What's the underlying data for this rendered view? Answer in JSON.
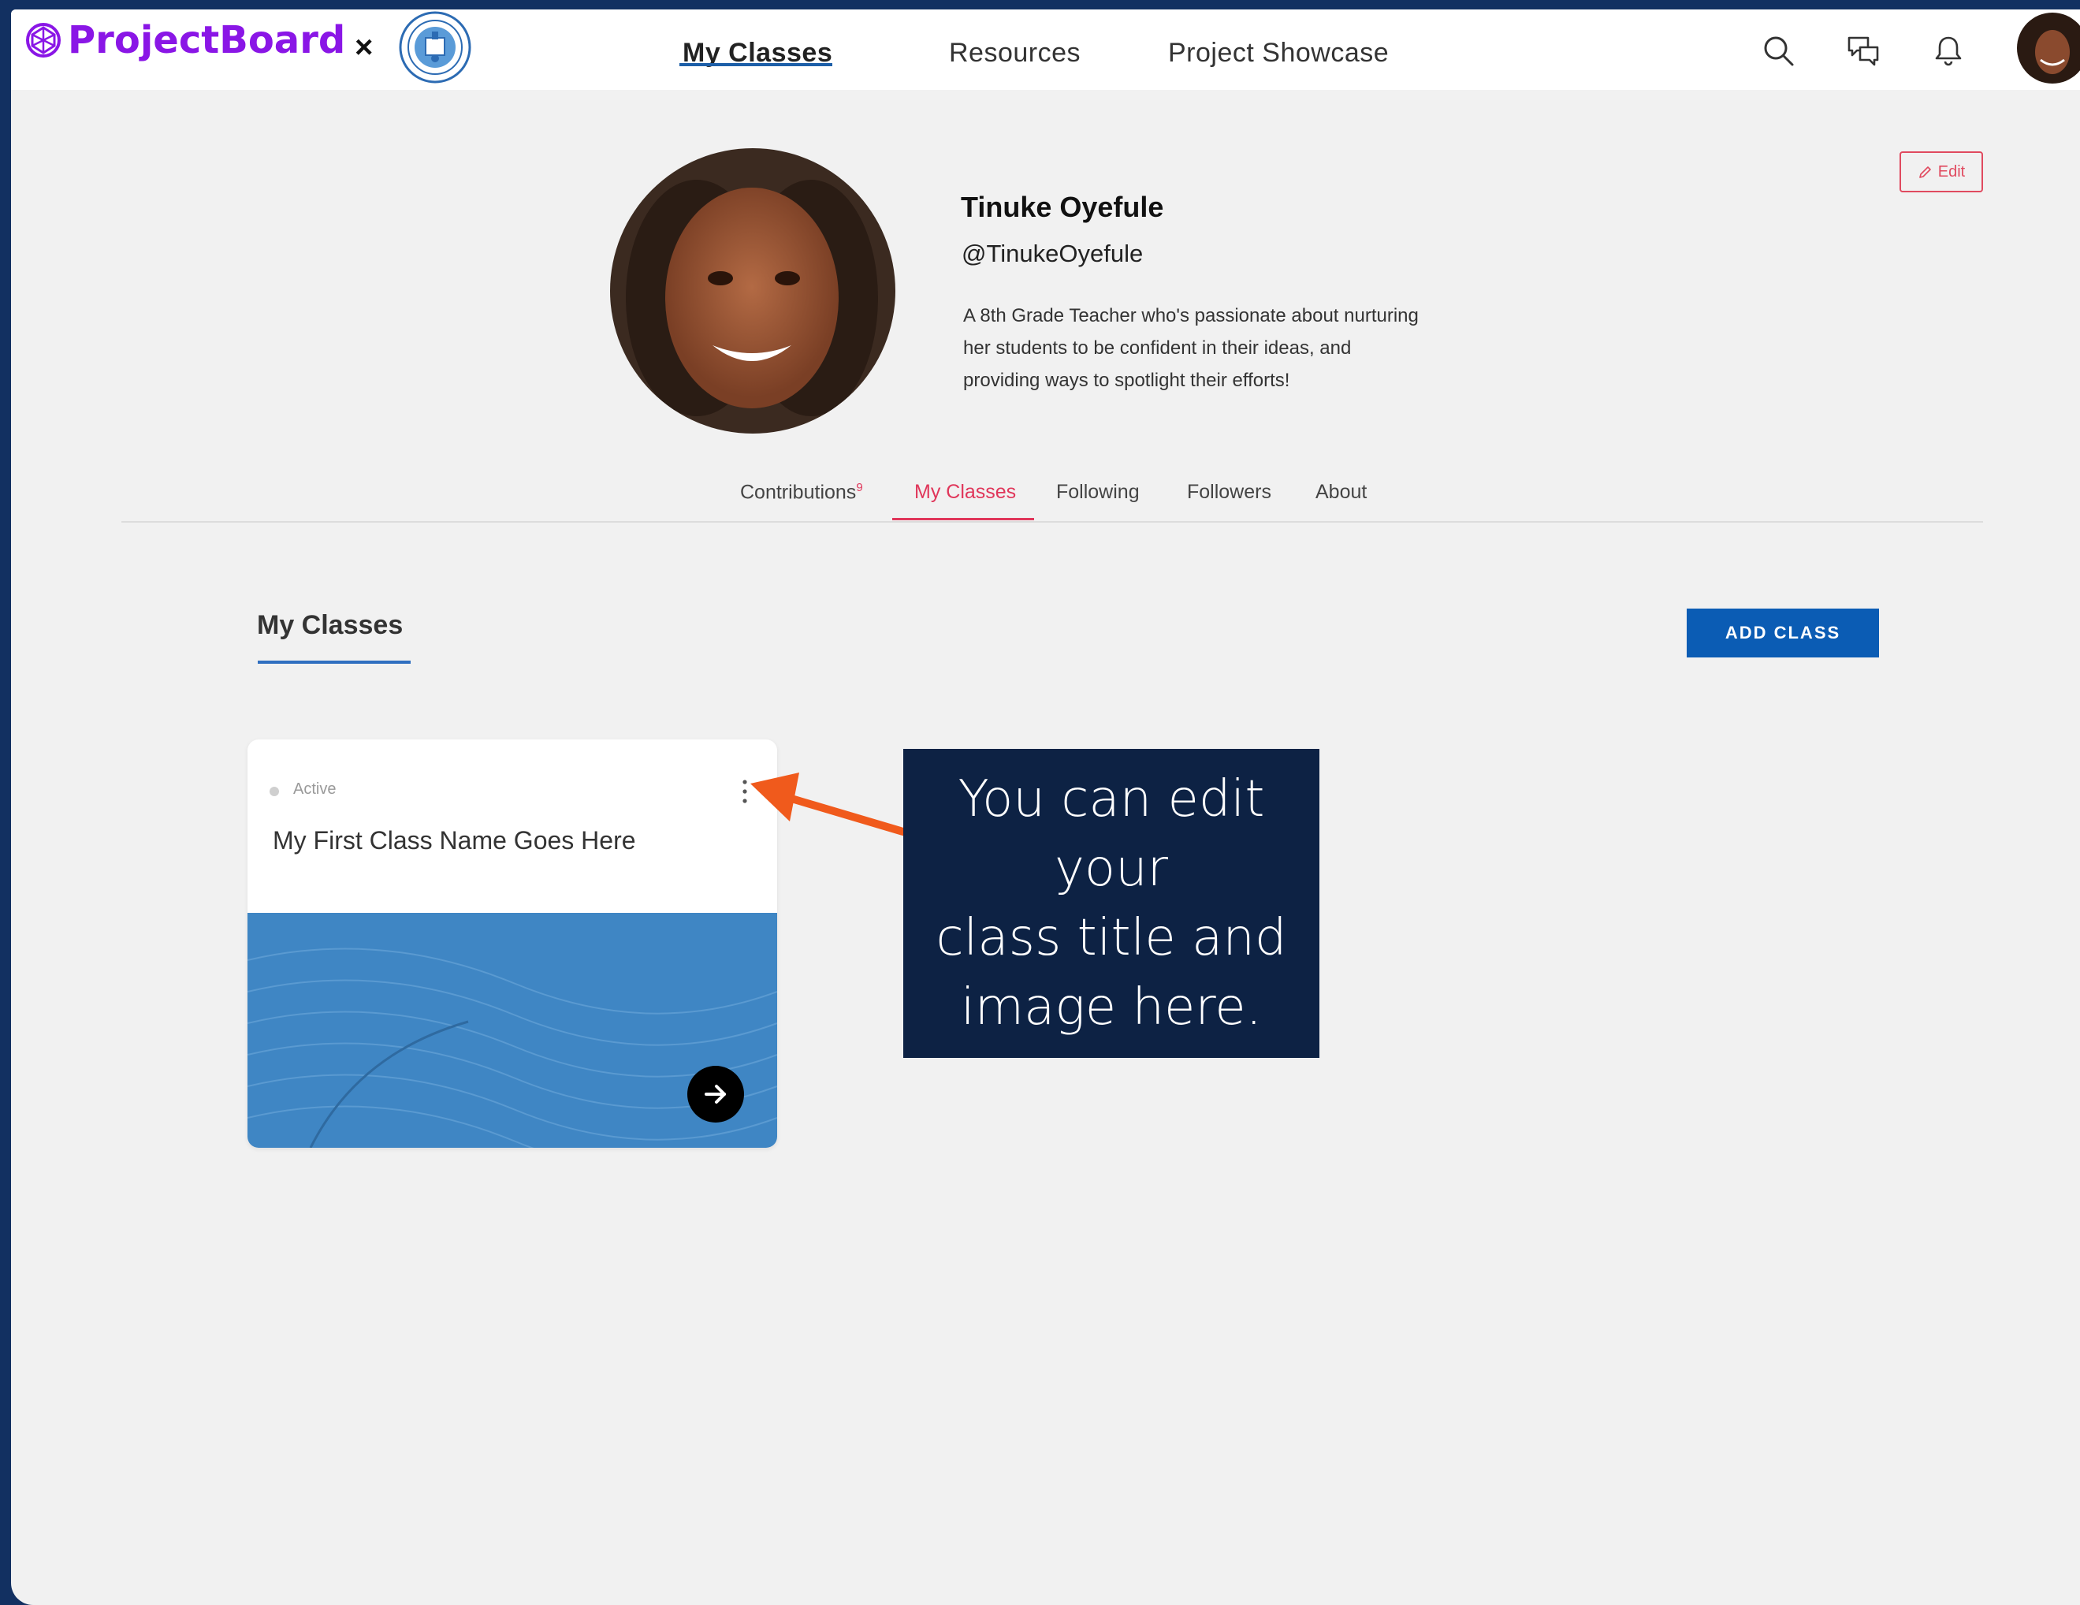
{
  "brand": {
    "name": "ProjectBoard",
    "separator": "×"
  },
  "nav": {
    "items": [
      "My Classes",
      "Resources",
      "Project Showcase"
    ],
    "active": "My Classes"
  },
  "icons": {
    "search": "search-icon",
    "chat": "chat-icon",
    "bell": "bell-icon",
    "edit": "pencil-icon",
    "arrow": "arrow-right-icon",
    "kebab": "kebab-menu-icon"
  },
  "profile": {
    "edit_label": "Edit",
    "name": "Tinuke Oyefule",
    "handle": "@TinukeOyefule",
    "bio_lines": [
      "A 8th Grade Teacher who's passionate about nurturing",
      "her students to be confident in their ideas, and",
      "providing ways to spotlight their efforts!"
    ]
  },
  "tabs": {
    "contributions": "Contributions",
    "contributions_count": "9",
    "my_classes": "My Classes",
    "following": "Following",
    "followers": "Followers",
    "about": "About",
    "active": "My Classes"
  },
  "section": {
    "title": "My Classes",
    "add_button": "ADD CLASS"
  },
  "class_card": {
    "status": "Active",
    "name": "My First Class Name Goes Here"
  },
  "callout": {
    "lines": [
      "You can edit your",
      "class title and",
      "image here."
    ]
  },
  "colors": {
    "brand": "#8a16e6",
    "accent_pink": "#e0365a",
    "button_blue": "#0b5cb4",
    "callout_bg": "#0d2244",
    "arrow_orange": "#f05a1c",
    "card_image": "#3f86c4"
  }
}
